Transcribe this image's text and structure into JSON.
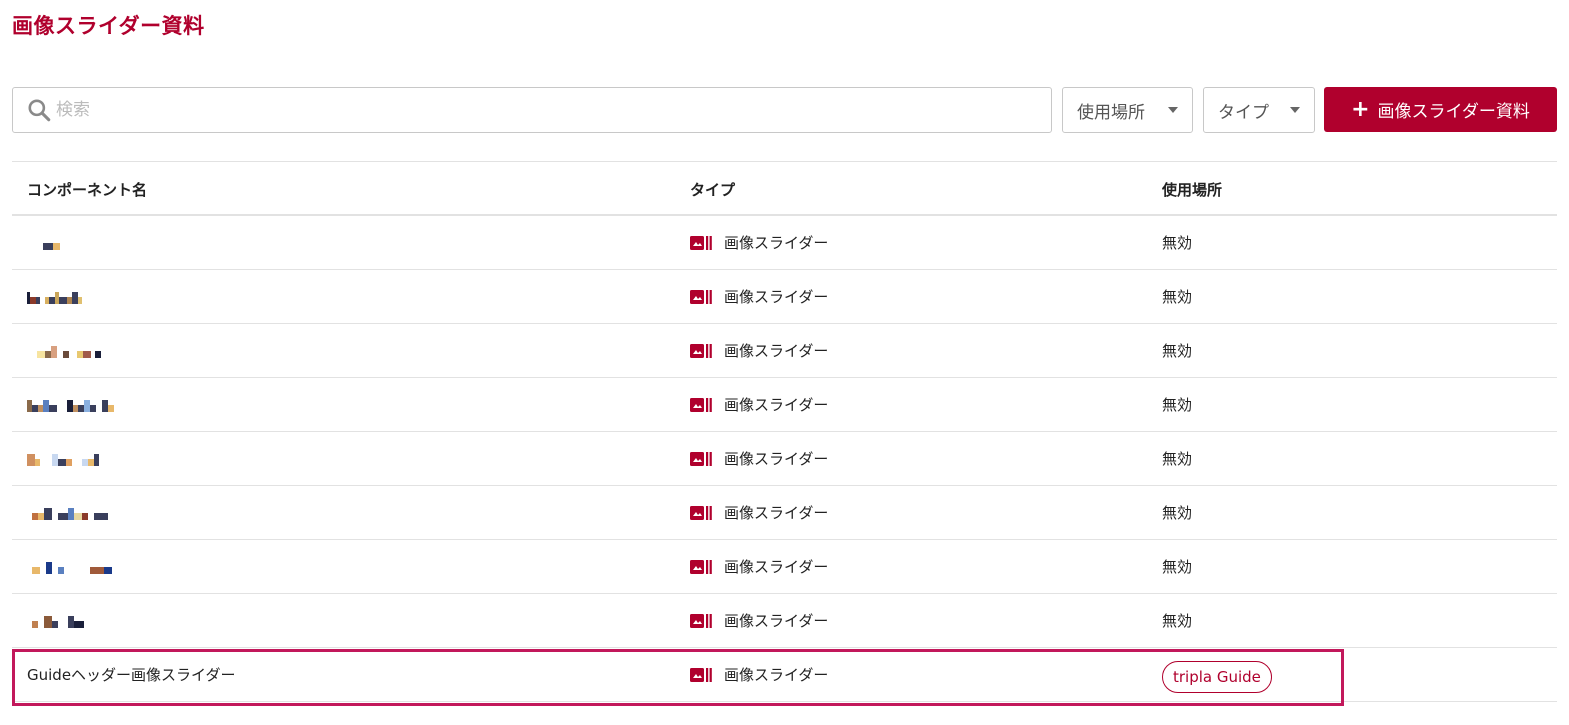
{
  "page": {
    "title": "画像スライダー資料"
  },
  "search": {
    "placeholder": "検索",
    "value": ""
  },
  "filters": {
    "usage_label": "使用場所",
    "type_label": "タイプ"
  },
  "add_button": {
    "icon": "+",
    "label": "画像スライダー資料"
  },
  "table": {
    "headers": {
      "name": "コンポーネント名",
      "type": "タイプ",
      "usage": "使用場所"
    },
    "rows": [
      {
        "name": "",
        "type": "画像スライダー",
        "usage": "無効"
      },
      {
        "name": "",
        "type": "画像スライダー",
        "usage": "無効"
      },
      {
        "name": "",
        "type": "画像スライダー",
        "usage": "無効"
      },
      {
        "name": "",
        "type": "画像スライダー",
        "usage": "無効"
      },
      {
        "name": "",
        "type": "画像スライダー",
        "usage": "無効"
      },
      {
        "name": "",
        "type": "画像スライダー",
        "usage": "無効"
      },
      {
        "name": "",
        "type": "画像スライダー",
        "usage": "無効"
      },
      {
        "name": "",
        "type": "画像スライダー",
        "usage": "無効"
      },
      {
        "name": "Guideヘッダー画像スライダー",
        "type": "画像スライダー",
        "usage": "tripla Guide"
      }
    ]
  },
  "colors": {
    "brand": "#b0002d",
    "highlight": "#c2185b"
  },
  "icons": {
    "search": "search-icon",
    "type": "image-slider-icon",
    "dropdown": "caret-down-icon"
  }
}
